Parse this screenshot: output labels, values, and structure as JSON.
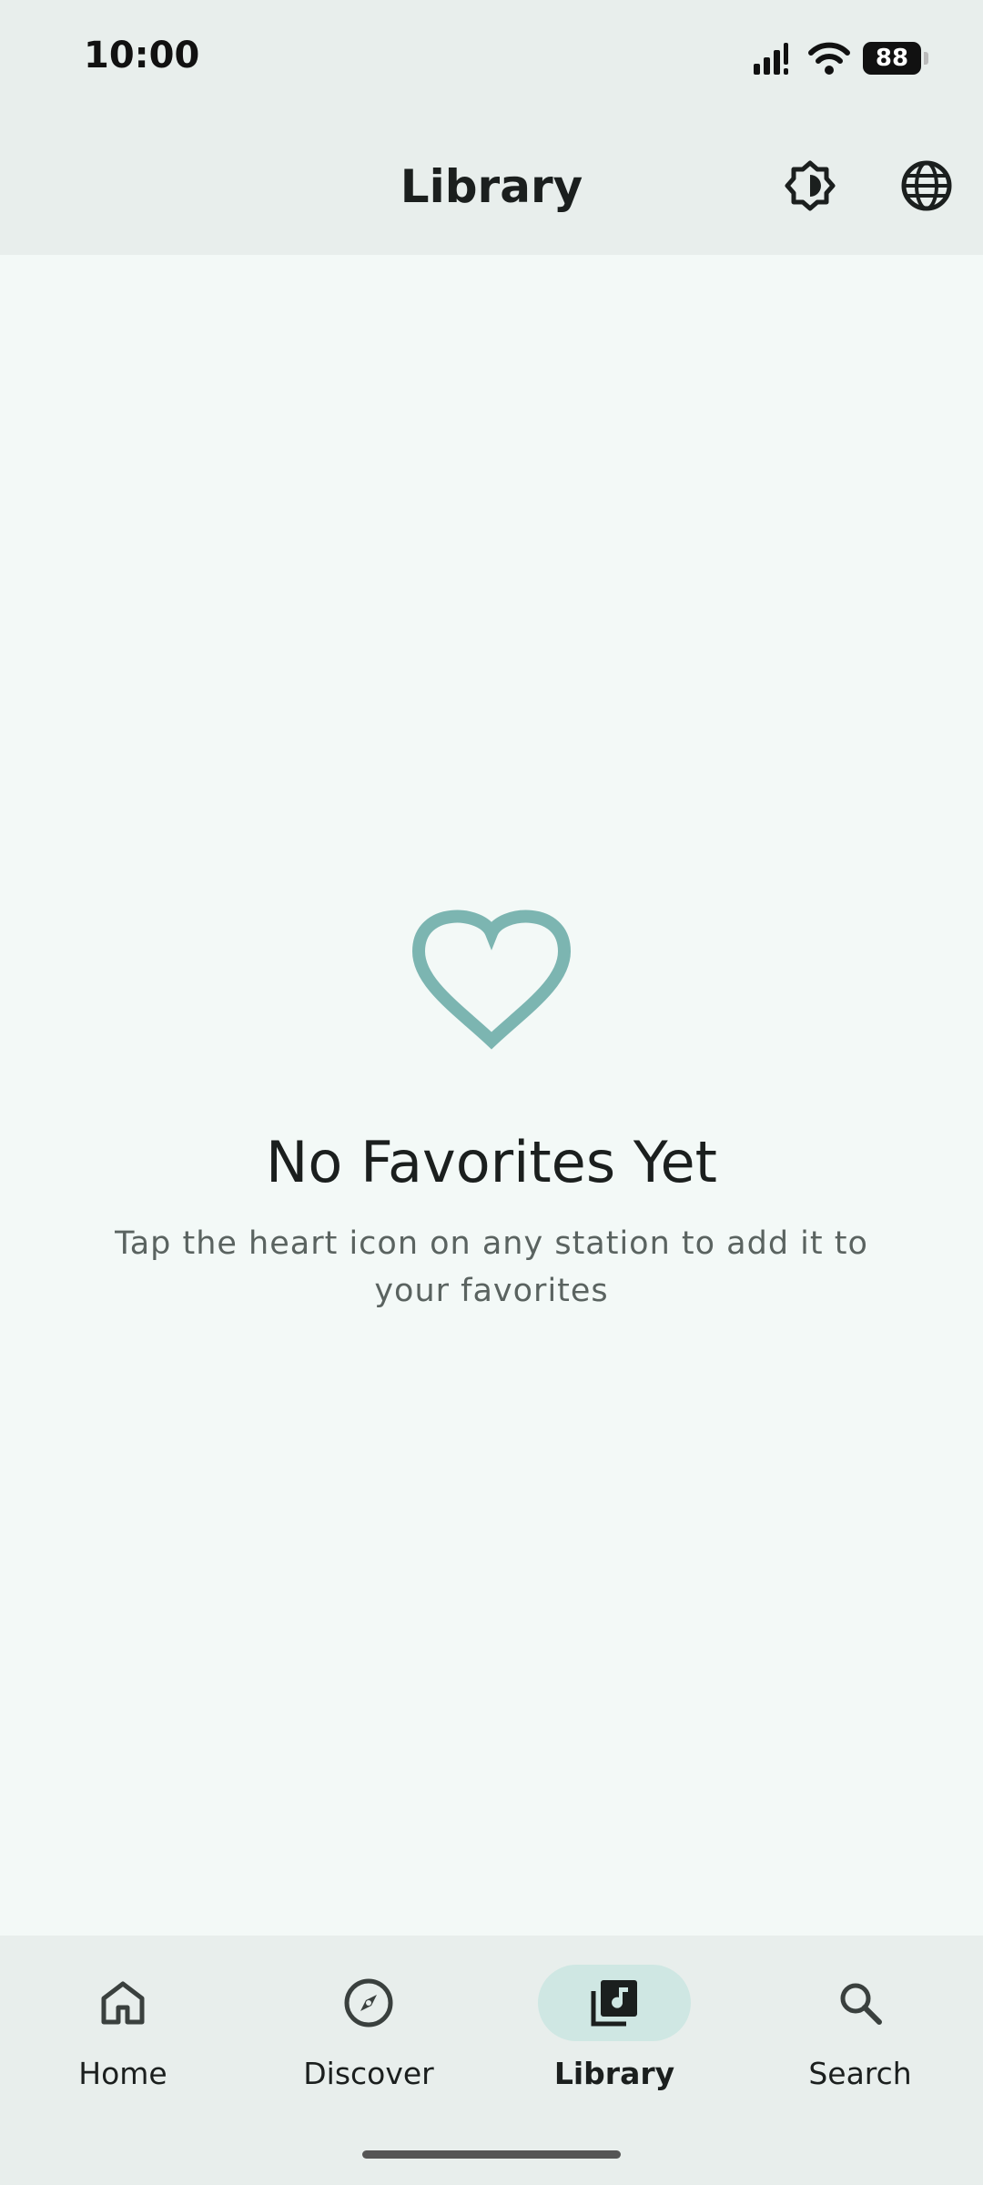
{
  "status_bar": {
    "time": "10:00",
    "battery": "88"
  },
  "app_bar": {
    "title": "Library",
    "theme_icon": "brightness-icon",
    "language_icon": "globe-icon"
  },
  "empty_state": {
    "icon": "heart-outline-icon",
    "title": "No Favorites Yet",
    "subtitle": "Tap the heart icon on any station to add it to your favorites"
  },
  "nav": {
    "items": [
      {
        "label": "Home",
        "icon": "home-icon"
      },
      {
        "label": "Discover",
        "icon": "compass-icon"
      },
      {
        "label": "Library",
        "icon": "library-music-icon",
        "active": true
      },
      {
        "label": "Search",
        "icon": "search-icon"
      }
    ]
  },
  "colors": {
    "accent": "#7cb5b1",
    "active_pill": "#cfe7e3",
    "bar_bg": "#e8eeec",
    "content_bg": "#f3f9f7"
  }
}
